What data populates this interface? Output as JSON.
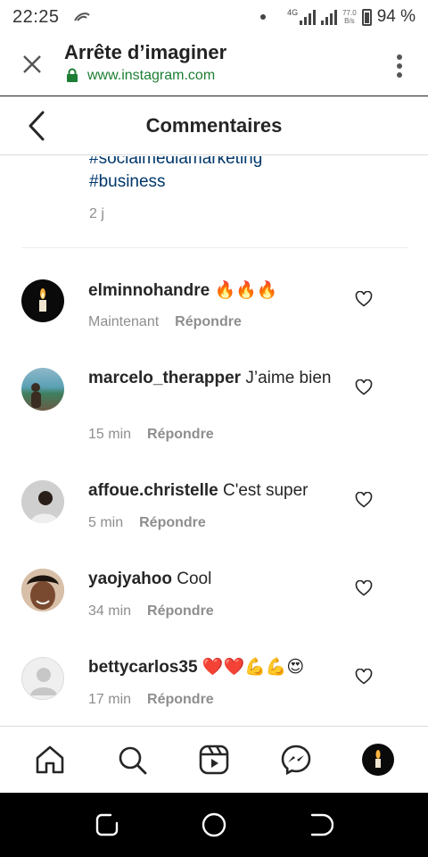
{
  "status_bar": {
    "time": "22:25",
    "network": "4G",
    "speed_value": "77.0",
    "speed_unit": "B/s",
    "battery": "94 %"
  },
  "browser": {
    "title": "Arrête d’imaginer",
    "url": "www.instagram.com",
    "accent_color": "#1e7e34"
  },
  "header": {
    "title": "Commentaires"
  },
  "caption": {
    "hashtag_partial": "#socialmediamarketing",
    "hashtag": "#business",
    "age": "2 j"
  },
  "comments": [
    {
      "username": "elminnohandre",
      "text": "🔥🔥🔥",
      "time": "Maintenant",
      "reply_label": "Répondre"
    },
    {
      "username": "marcelo_therapper",
      "text": "J’aime bien",
      "time": "15 min",
      "reply_label": "Répondre"
    },
    {
      "username": "affoue.christelle",
      "text": "C'est super",
      "time": "5 min",
      "reply_label": "Répondre"
    },
    {
      "username": "yaojyahoo",
      "text": "Cool",
      "time": "34 min",
      "reply_label": "Répondre"
    },
    {
      "username": "bettycarlos35",
      "text": "❤️❤️💪💪😍",
      "time": "17 min",
      "reply_label": "Répondre"
    }
  ],
  "bottom_nav": {
    "items": [
      "home-icon",
      "search-icon",
      "reels-icon",
      "messenger-icon",
      "profile-avatar"
    ]
  }
}
